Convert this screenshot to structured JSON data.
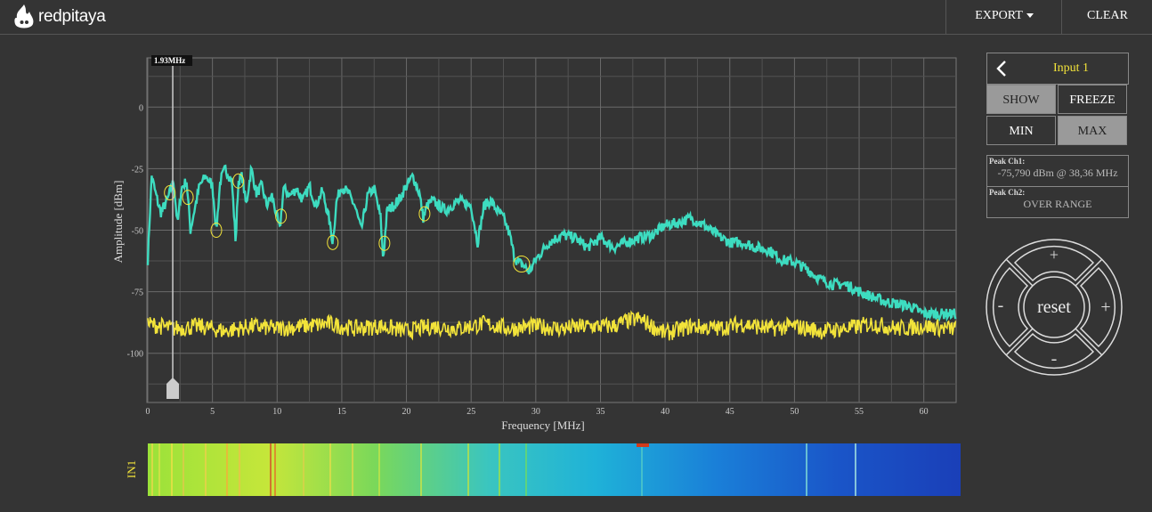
{
  "app": {
    "name": "redpitaya"
  },
  "toolbar": {
    "export_label": "EXPORT",
    "clear_label": "CLEAR"
  },
  "cursor": {
    "label": "1.93MHz",
    "freq_mhz": 1.93
  },
  "chart_data": {
    "type": "line",
    "xlabel": "Frequency   [MHz]",
    "ylabel": "Amplitude  [dBm]",
    "xlim": [
      0,
      62.5
    ],
    "ylim": [
      -120,
      20
    ],
    "xticks": [
      0,
      5,
      10,
      15,
      20,
      25,
      30,
      35,
      40,
      45,
      50,
      55,
      60
    ],
    "yticks": [
      0,
      -25,
      -50,
      -75,
      -100
    ],
    "grid": true,
    "series": [
      {
        "color": "#3ddcc0",
        "x": [
          0,
          0.3,
          0.6,
          1,
          1.5,
          2,
          2.3,
          2.6,
          3,
          3.3,
          3.6,
          4,
          4.5,
          5,
          5.3,
          5.6,
          6,
          6.5,
          6.8,
          7,
          7.3,
          7.6,
          8,
          8.4,
          8.8,
          9.2,
          9.6,
          10,
          10.2,
          10.5,
          11,
          11.5,
          12,
          12.5,
          13,
          13.5,
          14,
          14.3,
          14.6,
          15,
          15.5,
          16,
          16.5,
          17,
          17.5,
          18,
          18.2,
          18.5,
          19,
          19.5,
          20,
          20.5,
          21,
          21.3,
          21.6,
          22,
          23,
          24,
          25,
          25.5,
          26,
          26.5,
          27,
          27.5,
          28,
          28.3,
          28.6,
          29,
          29.5,
          30,
          31,
          32,
          33,
          34,
          35,
          36,
          37,
          38,
          39,
          40,
          41,
          42,
          43,
          44,
          45,
          46,
          47,
          48,
          49,
          50,
          51,
          52,
          53,
          54,
          55,
          56,
          57,
          58,
          59,
          60,
          61,
          62,
          62.5
        ],
        "y": [
          -62,
          -28,
          -35,
          -43,
          -38,
          -30,
          -48,
          -33,
          -30,
          -50,
          -42,
          -32,
          -28,
          -32,
          -50,
          -30,
          -25,
          -30,
          -55,
          -30,
          -28,
          -40,
          -25,
          -35,
          -32,
          -40,
          -36,
          -45,
          -50,
          -33,
          -36,
          -33,
          -38,
          -32,
          -40,
          -34,
          -45,
          -55,
          -38,
          -32,
          -35,
          -40,
          -50,
          -36,
          -33,
          -45,
          -62,
          -42,
          -40,
          -37,
          -32,
          -28,
          -35,
          -45,
          -40,
          -38,
          -42,
          -38,
          -40,
          -55,
          -40,
          -38,
          -42,
          -45,
          -52,
          -60,
          -63,
          -64,
          -67,
          -62,
          -55,
          -52,
          -53,
          -57,
          -53,
          -57,
          -55,
          -53,
          -52,
          -48,
          -47,
          -45,
          -48,
          -52,
          -55,
          -55,
          -57,
          -58,
          -62,
          -63,
          -66,
          -70,
          -72,
          -72,
          -75,
          -77,
          -79,
          -80,
          -81,
          -84,
          -84,
          -84,
          -84
        ]
      },
      {
        "color": "#f2e33a",
        "x": [
          0,
          2,
          4,
          6,
          8,
          10,
          12,
          14,
          16,
          18,
          20,
          22,
          24,
          26,
          28,
          30,
          32,
          34,
          36,
          37,
          38,
          39,
          40,
          42,
          44,
          46,
          48,
          50,
          52,
          54,
          56,
          58,
          60,
          62,
          62.5
        ],
        "y": [
          -88,
          -90,
          -89,
          -91,
          -89,
          -90,
          -89,
          -88,
          -90,
          -89,
          -91,
          -89,
          -90,
          -88,
          -90,
          -89,
          -90,
          -89,
          -89,
          -87,
          -86,
          -89,
          -92,
          -89,
          -90,
          -88,
          -90,
          -89,
          -91,
          -90,
          -88,
          -90,
          -89,
          -90,
          -90
        ]
      }
    ],
    "markers_x": [
      1.7,
      3.1,
      5.3,
      7.0,
      10.3,
      14.3,
      18.3,
      21.4,
      28.9
    ]
  },
  "channel": {
    "title": "Input 1",
    "show_label": "SHOW",
    "freeze_label": "FREEZE",
    "min_label": "MIN",
    "max_label": "MAX",
    "peak1_title": "Peak  Ch1:",
    "peak1_value": "-75,790  dBm @ 38,36  MHz",
    "peak2_title": "Peak  Ch2:",
    "peak2_value": "OVER RANGE"
  },
  "zoom": {
    "reset_label": "reset",
    "plus": "+",
    "minus": "-"
  },
  "waterfall": {
    "label": "IN1"
  }
}
